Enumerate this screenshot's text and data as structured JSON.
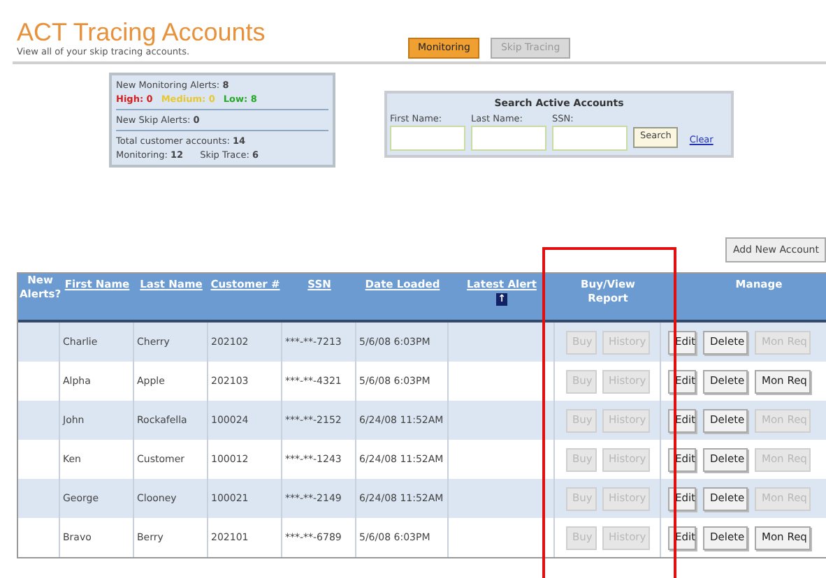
{
  "header": {
    "title": "ACT Tracing Accounts",
    "subtitle": "View all of your skip tracing accounts."
  },
  "tabs": [
    {
      "label": "Monitoring",
      "selected": true
    },
    {
      "label": "Skip Tracing",
      "selected": false
    }
  ],
  "summary": {
    "monitoring_alerts": "New Monitoring Alerts: **8**",
    "levels": [
      {
        "text": "High: 0",
        "color": "#d42020"
      },
      {
        "text": "Medium: 0",
        "color": "#e8c832"
      },
      {
        "text": "Low: 8",
        "color": "#28a828"
      }
    ],
    "skip_alerts": "New Skip Alerts: **0**",
    "total": "Total customer accounts: **14**",
    "monitoring": "Monitoring: **12**",
    "skip_trace": "Skip Trace: **6**"
  },
  "search": {
    "title": "Search Active Accounts",
    "fields": [
      {
        "label": "First Name:"
      },
      {
        "label": "Last Name:"
      },
      {
        "label": "SSN:"
      }
    ],
    "button": "Search",
    "clear": "Clear"
  },
  "add_button": "Add New Account",
  "table": {
    "columns": [
      "New Alerts?",
      "First Name",
      "Last Name",
      "Customer #",
      "SSN",
      "Date Loaded",
      "Latest Alert",
      "Buy/View Report",
      "Manage"
    ],
    "sort_icon": "↑",
    "rows": [
      {
        "first": "Charlie",
        "last": "Cherry",
        "customer": "202102",
        "ssn": "***-**-7213",
        "date": "5/6/08 6:03PM",
        "buttons": [
          {
            "label": "Buy",
            "disabled": true
          },
          {
            "label": "History",
            "disabled": true
          },
          {
            "label": "Edit",
            "disabled": false
          },
          {
            "label": "Delete",
            "disabled": false
          },
          {
            "label": "Mon Req",
            "disabled": true
          }
        ]
      },
      {
        "first": "Alpha",
        "last": "Apple",
        "customer": "202103",
        "ssn": "***-**-4321",
        "date": "5/6/08 6:03PM",
        "buttons": [
          {
            "label": "Buy",
            "disabled": true
          },
          {
            "label": "History",
            "disabled": true
          },
          {
            "label": "Edit",
            "disabled": false
          },
          {
            "label": "Delete",
            "disabled": false
          },
          {
            "label": "Mon Req",
            "disabled": false
          }
        ]
      },
      {
        "first": "John",
        "last": "Rockafella",
        "customer": "100024",
        "ssn": "***-**-2152",
        "date": "6/24/08 11:52AM",
        "buttons": [
          {
            "label": "Buy",
            "disabled": true
          },
          {
            "label": "History",
            "disabled": true
          },
          {
            "label": "Edit",
            "disabled": false
          },
          {
            "label": "Delete",
            "disabled": false
          },
          {
            "label": "Mon Req",
            "disabled": true
          }
        ]
      },
      {
        "first": "Ken",
        "last": "Customer",
        "customer": "100012",
        "ssn": "***-**-1243",
        "date": "6/24/08 11:52AM",
        "buttons": [
          {
            "label": "Buy",
            "disabled": true
          },
          {
            "label": "History",
            "disabled": true
          },
          {
            "label": "Edit",
            "disabled": false
          },
          {
            "label": "Delete",
            "disabled": false
          },
          {
            "label": "Mon Req",
            "disabled": true
          }
        ]
      },
      {
        "first": "George",
        "last": "Clooney",
        "customer": "100021",
        "ssn": "***-**-2149",
        "date": "6/24/08 11:52AM",
        "buttons": [
          {
            "label": "Buy",
            "disabled": true
          },
          {
            "label": "History",
            "disabled": true
          },
          {
            "label": "Edit",
            "disabled": false
          },
          {
            "label": "Delete",
            "disabled": false
          },
          {
            "label": "Mon Req",
            "disabled": true
          }
        ]
      },
      {
        "first": "Bravo",
        "last": "Berry",
        "customer": "202101",
        "ssn": "***-**-6789",
        "date": "5/6/08 6:03PM",
        "buttons": [
          {
            "label": "Buy",
            "disabled": true
          },
          {
            "label": "History",
            "disabled": true
          },
          {
            "label": "Edit",
            "disabled": false
          },
          {
            "label": "Delete",
            "disabled": false
          },
          {
            "label": "Mon Req",
            "disabled": false
          }
        ]
      }
    ]
  }
}
